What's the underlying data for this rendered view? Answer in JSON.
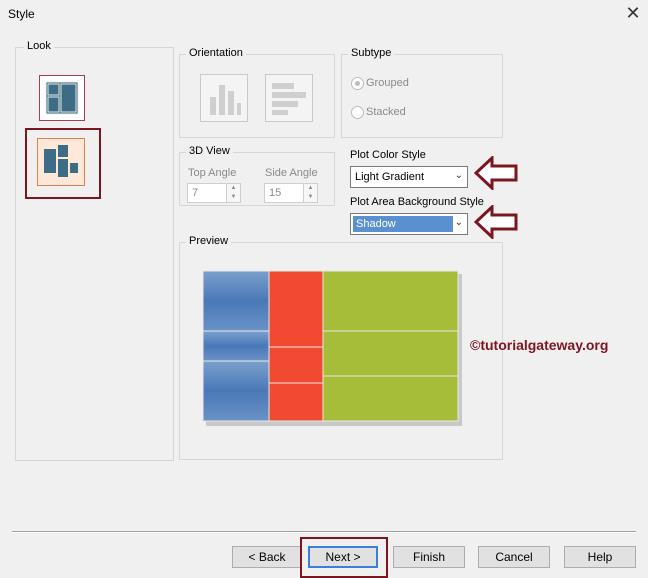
{
  "window": {
    "title": "Style",
    "close_glyph": "✕"
  },
  "look": {
    "label": "Look"
  },
  "orientation": {
    "label": "Orientation"
  },
  "subtype": {
    "label": "Subtype",
    "options": [
      {
        "label": "Grouped",
        "selected": true
      },
      {
        "label": "Stacked",
        "selected": false
      }
    ]
  },
  "view3d": {
    "label": "3D View",
    "top_angle_label": "Top Angle",
    "top_angle_value": "7",
    "side_angle_label": "Side Angle",
    "side_angle_value": "15"
  },
  "plot_color_style": {
    "label": "Plot Color Style",
    "value": "Light Gradient"
  },
  "plot_area_bg": {
    "label": "Plot Area Background Style",
    "value": "Shadow"
  },
  "preview": {
    "label": "Preview"
  },
  "watermark": "©tutorialgateway.org",
  "buttons": {
    "back": "< Back",
    "next": "Next >",
    "finish": "Finish",
    "cancel": "Cancel",
    "help": "Help"
  },
  "colors": {
    "accent_red": "#7b1621",
    "blue": "#4a78b8",
    "red": "#f04a30",
    "green": "#a6bd3a"
  }
}
